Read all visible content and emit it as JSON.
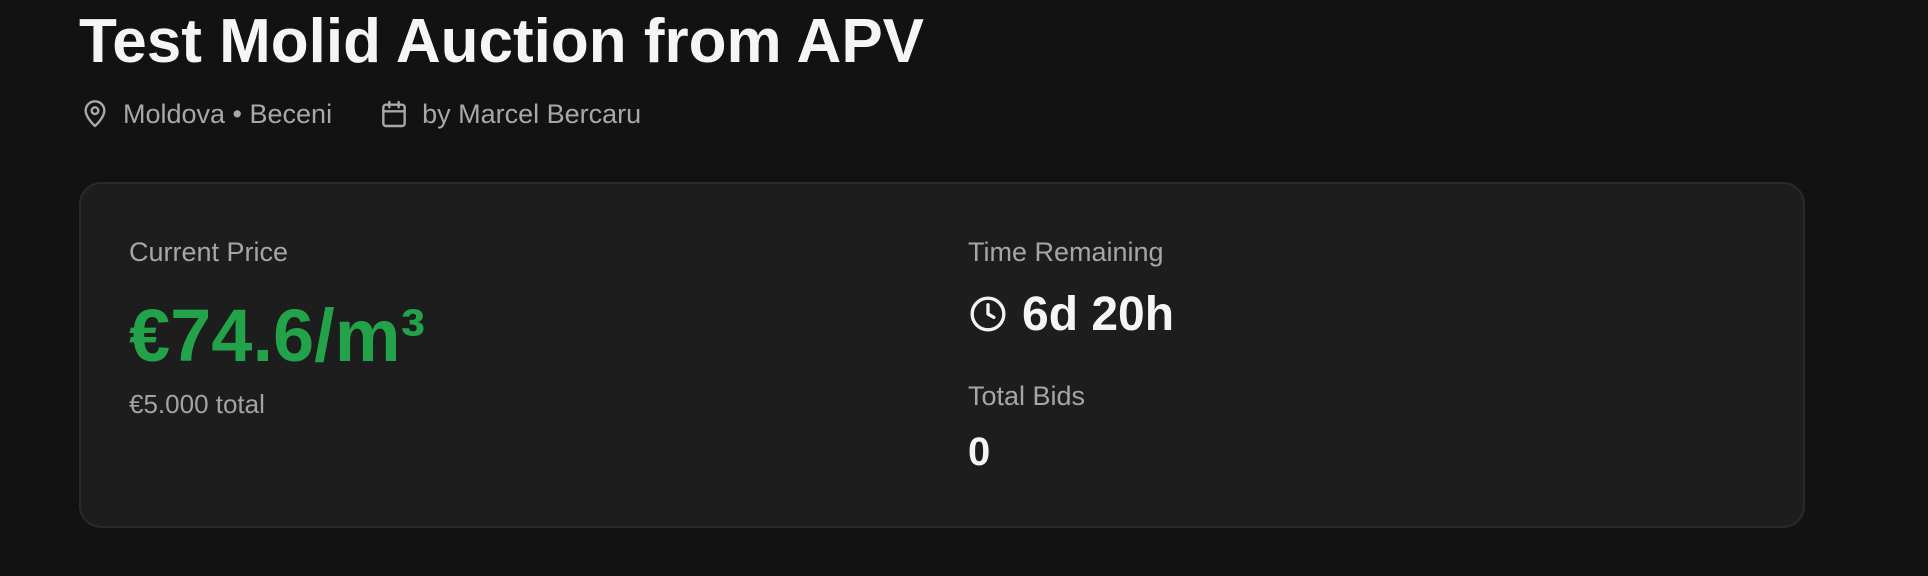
{
  "auction": {
    "title": "Test Molid Auction from APV",
    "location": "Moldova • Beceni",
    "author": "by Marcel Bercaru"
  },
  "price_card": {
    "current_price_label": "Current Price",
    "current_price": "€74.6/m³",
    "total": "€5.000 total",
    "time_remaining_label": "Time Remaining",
    "time_remaining": "6d 20h",
    "total_bids_label": "Total Bids",
    "total_bids": "0"
  },
  "icons": {
    "location": "map-pin-icon",
    "date": "calendar-icon",
    "time": "clock-icon"
  },
  "colors": {
    "background": "#121212",
    "card": "#1d1d1d",
    "price_accent": "#22a34a"
  }
}
